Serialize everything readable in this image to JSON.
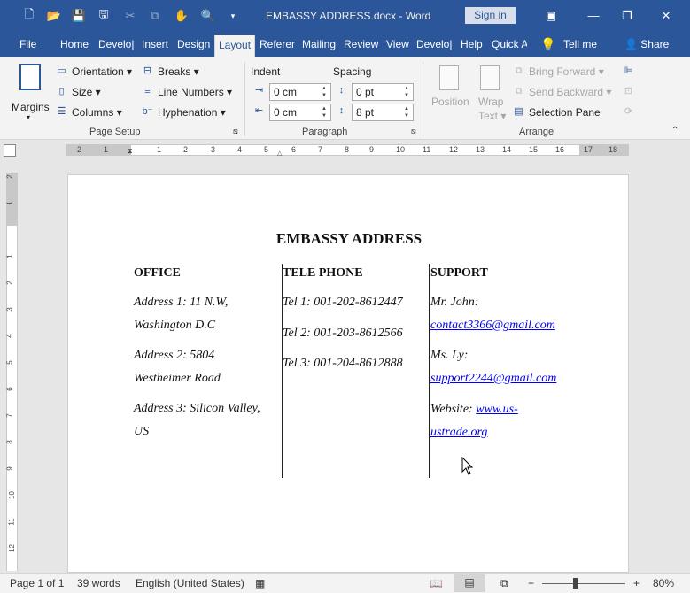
{
  "titlebar": {
    "title": "EMBASSY ADDRESS.docx  -  Word",
    "sign_in": "Sign in",
    "minimize": "—",
    "restore": "❐",
    "close": "✕",
    "ribbon_display": "▣"
  },
  "tabs": [
    "File",
    "Home",
    "Develo|",
    "Insert",
    "Design",
    "Layout",
    "Referen",
    "Mailing",
    "Review",
    "View",
    "Develo|",
    "Help",
    "Quick A"
  ],
  "tell_me": "Tell me",
  "share": "Share",
  "ribbon": {
    "margins": "Margins",
    "orientation": "Orientation",
    "size": "Size",
    "columns": "Columns",
    "breaks": "Breaks",
    "line_numbers": "Line Numbers",
    "hyphenation": "Hyphenation",
    "page_setup_label": "Page Setup",
    "indent": "Indent",
    "spacing": "Spacing",
    "indent_left": "0 cm",
    "indent_right": "0 cm",
    "spacing_before": "0 pt",
    "spacing_after": "8 pt",
    "paragraph_label": "Paragraph",
    "position": "Position",
    "wrap": "Wrap",
    "text": "Text",
    "bring_forward": "Bring Forward",
    "send_backward": "Send Backward",
    "selection_pane": "Selection Pane",
    "arrange_label": "Arrange"
  },
  "ruler": [
    "2",
    "1",
    "1",
    "2",
    "3",
    "4",
    "5",
    "6",
    "7",
    "8",
    "9",
    "10",
    "11",
    "12",
    "13",
    "14",
    "15",
    "16",
    "17",
    "18"
  ],
  "vruler": [
    "2",
    "1",
    "1",
    "2",
    "3",
    "4",
    "5",
    "6",
    "7",
    "8",
    "9",
    "10",
    "11",
    "12"
  ],
  "document": {
    "title": "EMBASSY ADDRESS",
    "headers": [
      "OFFICE",
      "TELE PHONE",
      "SUPPORT"
    ],
    "office": [
      [
        "Address 1: 11 N.W,",
        "Washington D.C"
      ],
      [
        "Address 2: 5804",
        "Westheimer Road"
      ],
      [
        "Address 3: Silicon Valley,",
        "US"
      ]
    ],
    "phones": [
      "Tel 1: 001-202-8612447",
      "Tel 2: 001-203-8612566",
      "Tel 3: 001-204-8612888"
    ],
    "support": {
      "john_label": "Mr. John:",
      "john_email": "contact3366@gmail.com",
      "ly_label": "Ms. Ly:",
      "ly_email": "support2244@gmail.com",
      "website_label": "Website: ",
      "website_1": "www.us-",
      "website_2": "ustrade.org"
    }
  },
  "status": {
    "page": "Page 1 of 1",
    "words": "39 words",
    "language": "English (United States)",
    "zoom": "80%",
    "zoom_minus": "−",
    "zoom_plus": "+"
  }
}
